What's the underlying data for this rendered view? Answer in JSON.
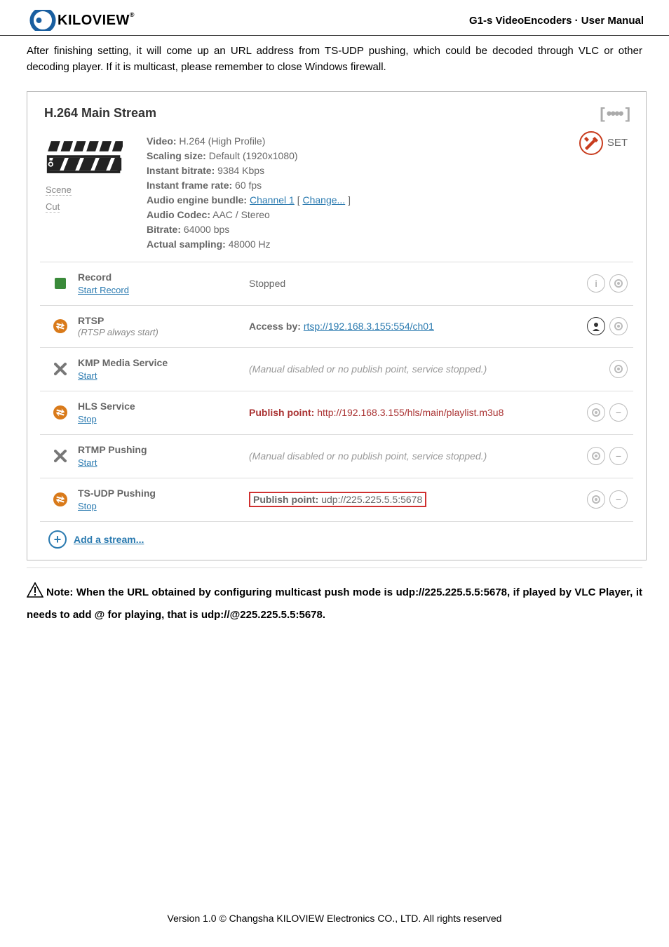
{
  "header": {
    "brand": "KILOVIEW",
    "right": "G1-s VideoEncoders · User Manual"
  },
  "intro": "After finishing setting, it will come up an URL address from TS-UDP pushing, which could be decoded through VLC or other decoding player. If it is multicast, please remember to close Windows firewall.",
  "panel": {
    "title": "H.264 Main Stream",
    "sceneLabel": "Scene",
    "cutLabel": "Cut",
    "setLabel": "SET",
    "info": {
      "videoLabel": "Video:",
      "videoValue": " H.264 (High Profile)",
      "scaleLabel": "Scaling size:",
      "scaleValue": " Default (1920x1080)",
      "bitrateLabel": "Instant bitrate:",
      "bitrateValue": " 9384 Kbps",
      "frameLabel": "Instant frame rate:",
      "frameValue": " 60 fps",
      "audioEngLabel": "Audio engine bundle:",
      "audioEngLink1": "Channel 1",
      "audioEngSep": " [ ",
      "audioEngLink2": "Change...",
      "audioEngEnd": " ]",
      "audioCodecLabel": "Audio Codec:",
      "audioCodecValue": " AAC / Stereo",
      "brLabel": "Bitrate:",
      "brValue": " 64000 bps",
      "sampLabel": "Actual sampling:",
      "sampValue": " 48000 Hz"
    },
    "rows": {
      "record": {
        "title": "Record",
        "link": "Start Record",
        "status": "Stopped"
      },
      "rtsp": {
        "title": "RTSP",
        "sub": "(RTSP always start)",
        "lbl": "Access by: ",
        "url": "rtsp://192.168.3.155:554/ch01"
      },
      "kmp": {
        "title": "KMP Media Service",
        "link": "Start",
        "status": "(Manual disabled or no publish point, service stopped.)"
      },
      "hls": {
        "title": "HLS Service",
        "link": "Stop",
        "lbl": "Publish point: ",
        "url": "http://192.168.3.155/hls/main/playlist.m3u8"
      },
      "rtmp": {
        "title": "RTMP Pushing",
        "link": "Start",
        "status": "(Manual disabled or no publish point, service stopped.)"
      },
      "tsudp": {
        "title": "TS-UDP Pushing",
        "link": "Stop",
        "lbl": "Publish point: ",
        "url": "udp://225.225.5.5:5678"
      }
    },
    "addLabel": "Add a stream..."
  },
  "note": {
    "prefix": "Note: When the URL obtained by configuring multicast push mode is udp://225.225.5.5:5678, if played by VLC Player, it needs to add @ for playing, that is udp://@225.225.5.5:5678."
  },
  "footer": "Version 1.0 © Changsha KILOVIEW Electronics CO., LTD. All rights reserved"
}
